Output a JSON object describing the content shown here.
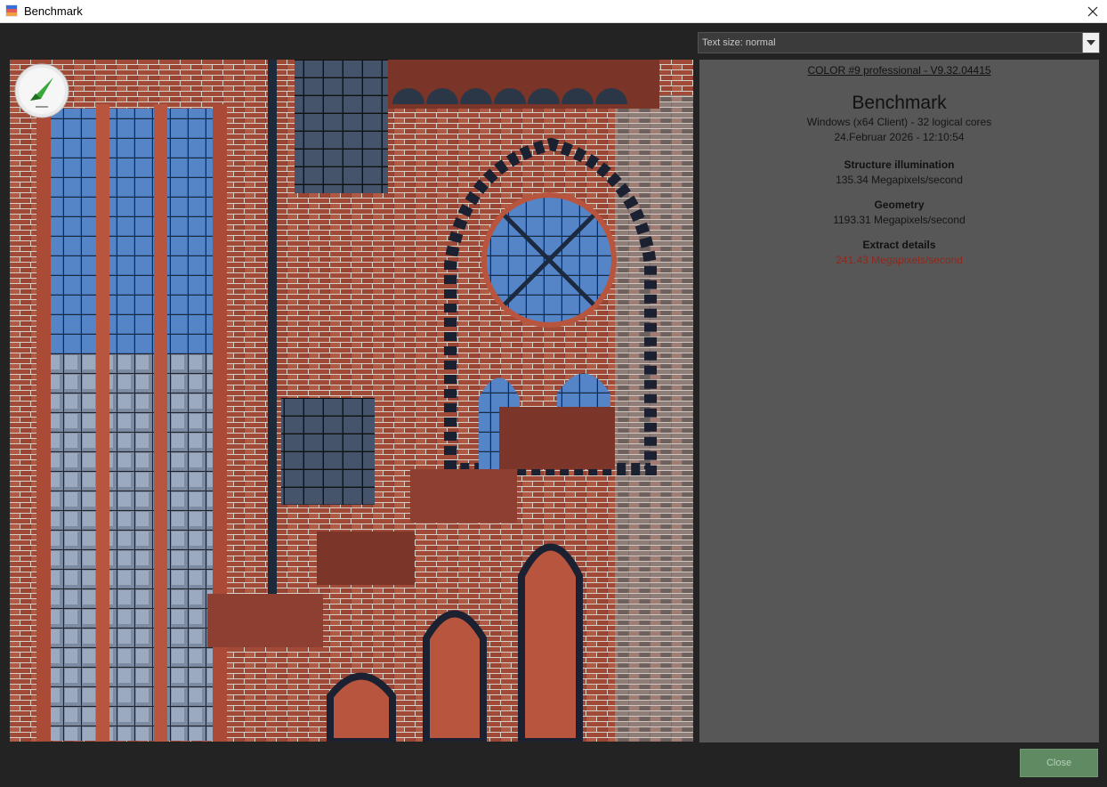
{
  "window": {
    "title": "Benchmark",
    "icon": "app-icon",
    "close_icon": "close-icon"
  },
  "toolbar": {
    "text_size_select": "Text size: normal"
  },
  "image": {
    "description_icon": "benchmark-gauge-icon"
  },
  "results": {
    "version": "COLOR #9 professional - V9.32.04415",
    "title": "Benchmark",
    "system": "Windows (x64 Client) - 32 logical cores",
    "date": "24.Februar 2026 - 12:10:54",
    "items": [
      {
        "label": "Structure illumination",
        "value": "135.34 Megapixels/second"
      },
      {
        "label": "Geometry",
        "value": "1193.31 Megapixels/second"
      },
      {
        "label": "Extract details",
        "value": "241.43 Megapixels/second",
        "highlight": "#8b2a1d"
      }
    ]
  },
  "footer": {
    "close_label": "Close"
  },
  "colors": {
    "background": "#232323",
    "panel": "#575757",
    "close_button": "#5f8a62"
  }
}
